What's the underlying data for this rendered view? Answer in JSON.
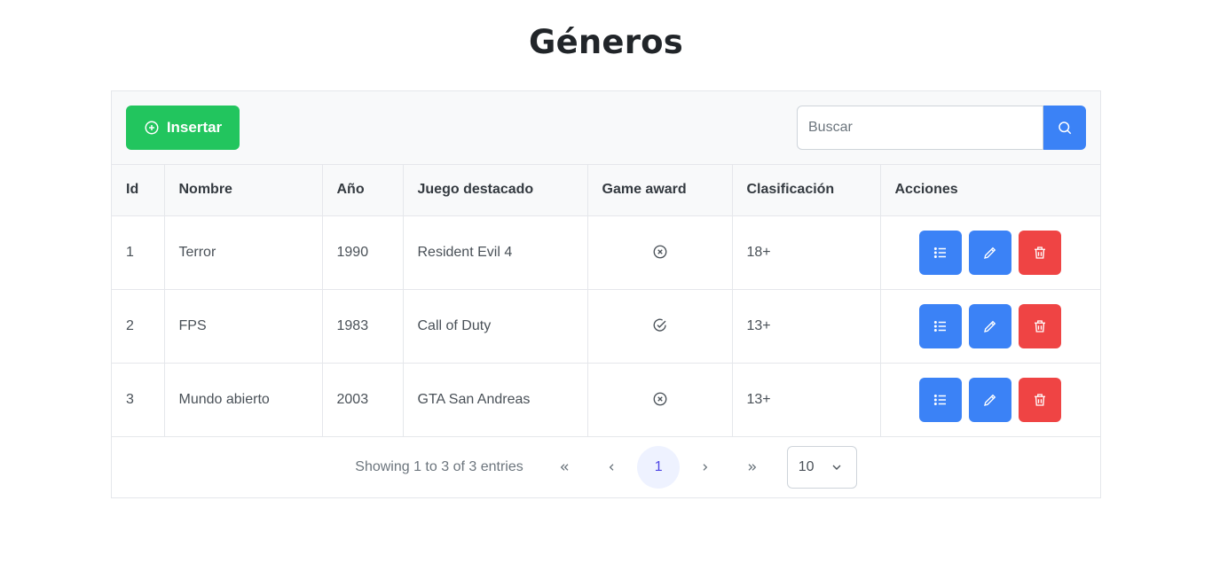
{
  "page": {
    "title": "Géneros"
  },
  "toolbar": {
    "insert_label": "Insertar",
    "search_placeholder": "Buscar"
  },
  "table": {
    "headers": [
      "Id",
      "Nombre",
      "Año",
      "Juego destacado",
      "Game award",
      "Clasificación",
      "Acciones"
    ],
    "rows": [
      {
        "id": "1",
        "nombre": "Terror",
        "anio": "1990",
        "juego": "Resident Evil 4",
        "award_icon": "times-circle-icon",
        "clasificacion": "18+"
      },
      {
        "id": "2",
        "nombre": "FPS",
        "anio": "1983",
        "juego": "Call of Duty",
        "award_icon": "check-circle-icon",
        "clasificacion": "13+"
      },
      {
        "id": "3",
        "nombre": "Mundo abierto",
        "anio": "2003",
        "juego": "GTA San Andreas",
        "award_icon": "times-circle-icon",
        "clasificacion": "13+"
      }
    ]
  },
  "paginator": {
    "summary": "Showing 1 to 3 of 3 entries",
    "current_page": "1",
    "rows_per_page": "10"
  },
  "colors": {
    "insert": "#22c55e",
    "primary": "#3b82f6",
    "danger": "#ef4444"
  }
}
